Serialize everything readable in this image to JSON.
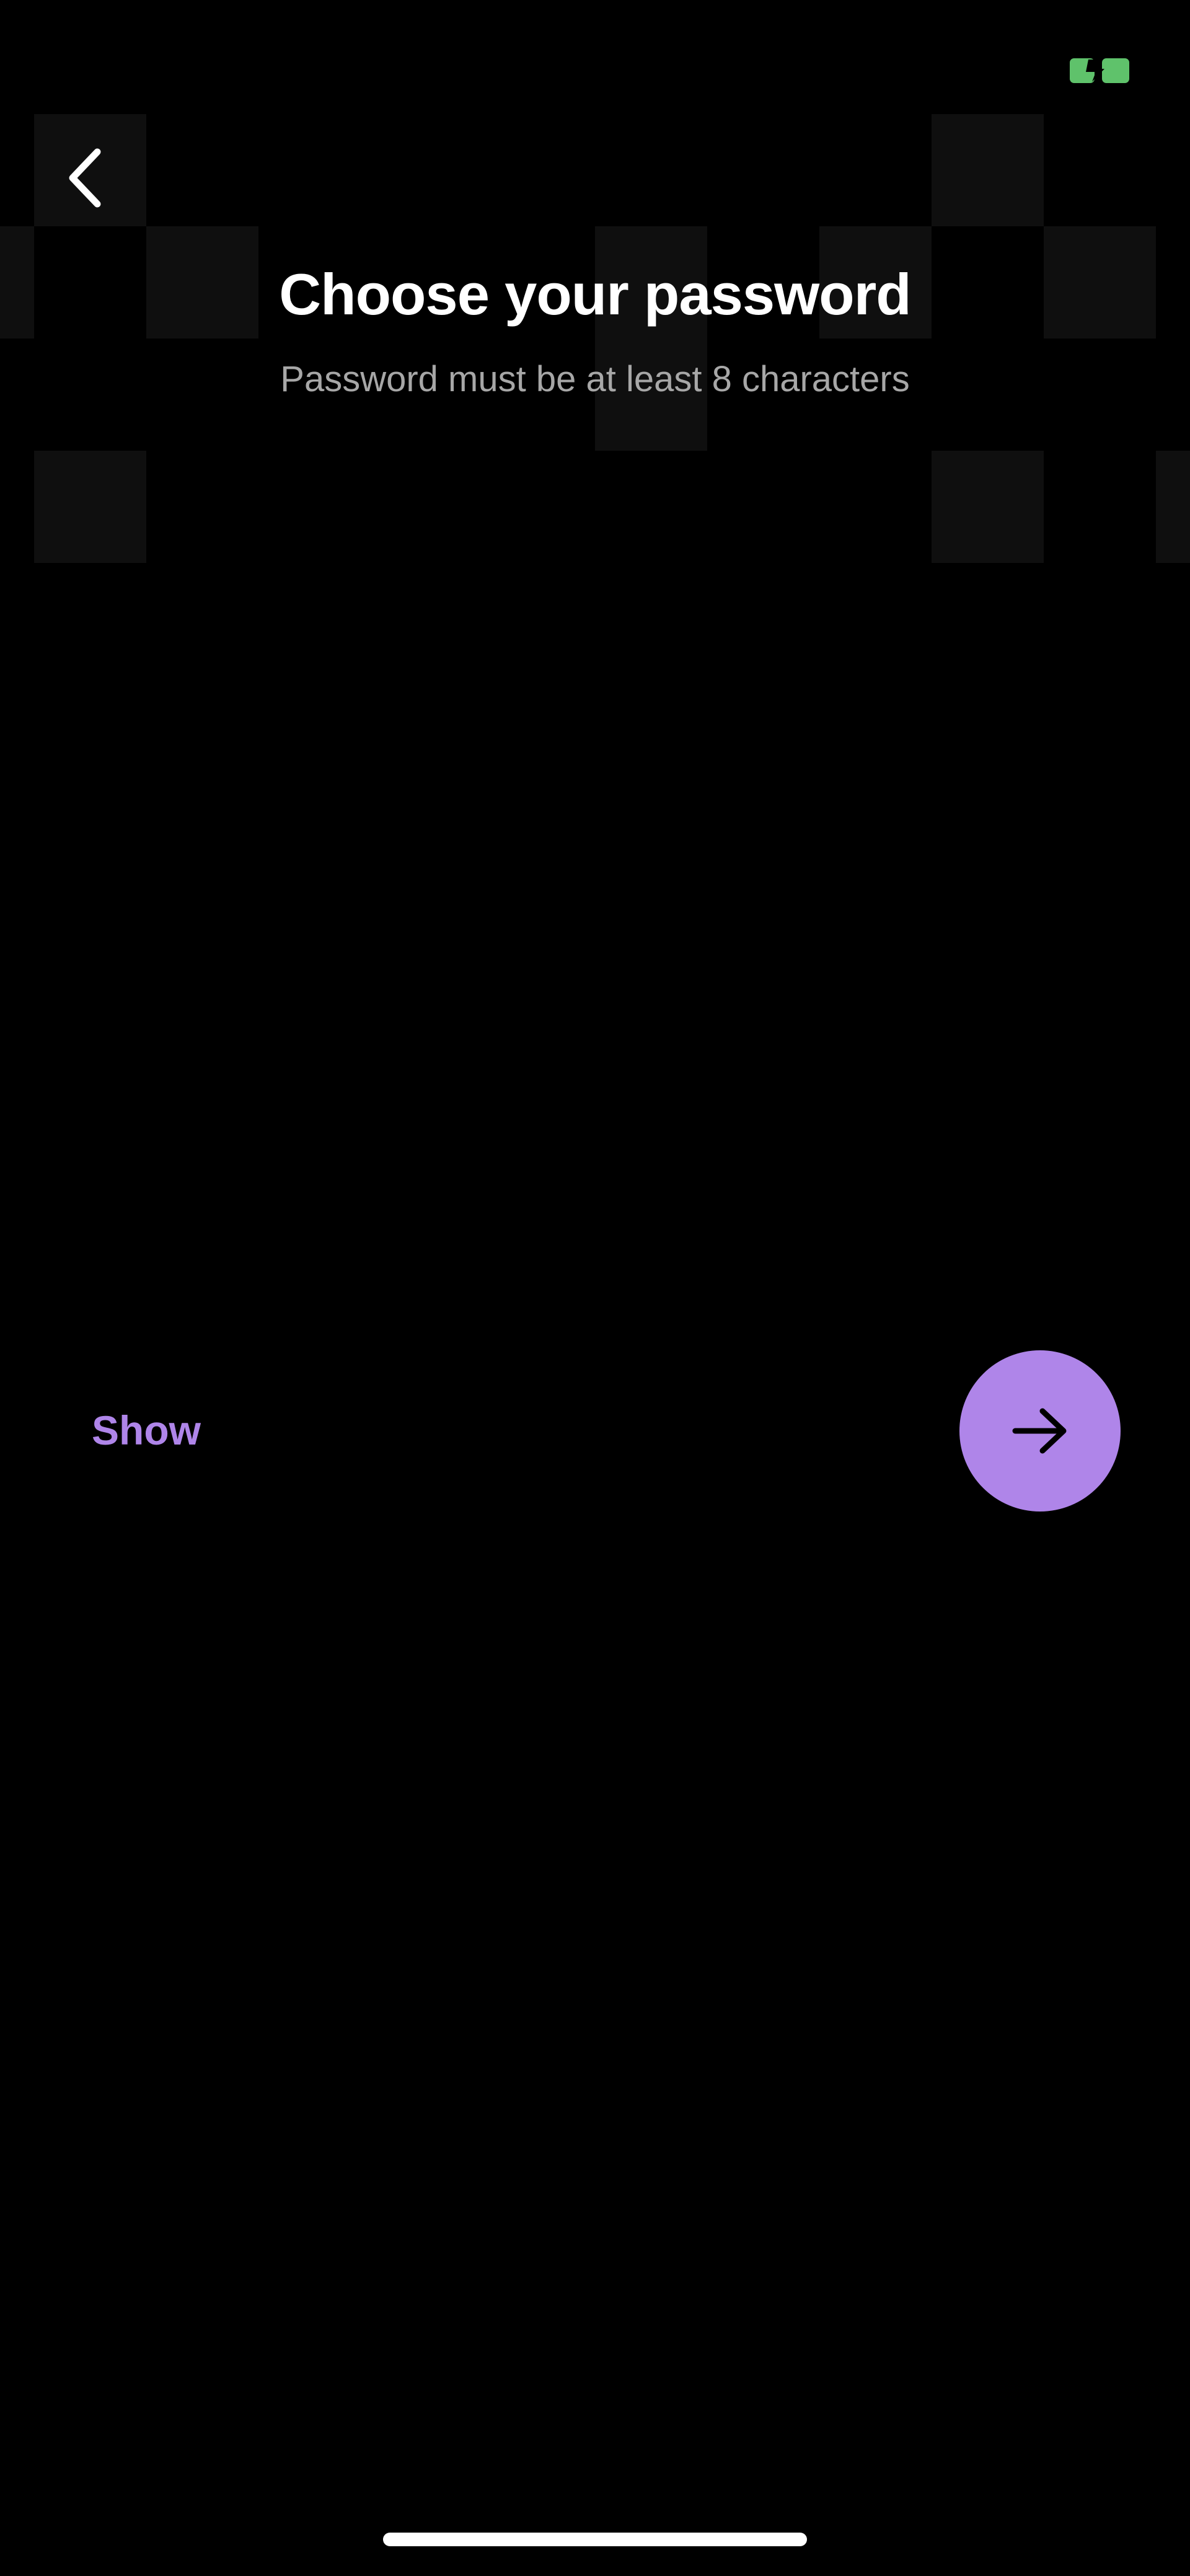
{
  "status_bar": {
    "battery_icon": "battery-charging-icon",
    "battery_color": "#5fc26b"
  },
  "header": {
    "back_icon": "chevron-left-icon",
    "title": "Choose your password",
    "subtitle": "Password must be at least 8 characters"
  },
  "form": {
    "password_value": "",
    "show_label": "Show",
    "next_icon": "arrow-right-icon"
  },
  "colors": {
    "background": "#000000",
    "accent": "#af85e9",
    "pattern_tile": "#0f0f0f",
    "subtitle_text": "#a7a7a7"
  }
}
